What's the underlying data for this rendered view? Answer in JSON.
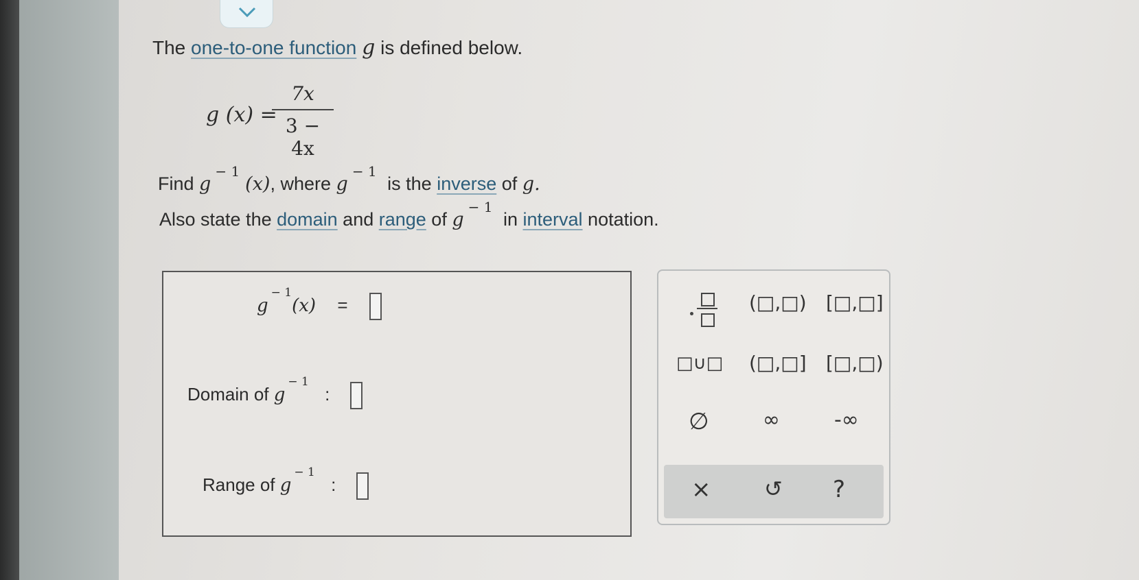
{
  "question": {
    "intro_pre": "The ",
    "intro_link": "one-to-one function",
    "intro_var": "g",
    "intro_post": " is defined below.",
    "formula_lhs": "g (x) =",
    "formula_num": "7x",
    "formula_den": "3 − 4x",
    "find_pre": "Find ",
    "find_g": "g",
    "find_x": "(x)",
    "find_where": ", where ",
    "find_g2": "g",
    "find_is": " is the ",
    "find_link": "inverse",
    "find_of": " of ",
    "find_g3": "g.",
    "also_pre": "Also state the ",
    "also_domain": "domain",
    "also_and": " and ",
    "also_range": "range",
    "also_of": " of ",
    "also_g": "g",
    "also_in": " in ",
    "also_interval": "interval",
    "also_post": " notation.",
    "inv_sup": "− 1"
  },
  "answer": {
    "inv_label_g": "g",
    "inv_label_x": "(x)",
    "equals": "=",
    "domain_label": "Domain of ",
    "range_label": "Range of ",
    "colon": ":",
    "sup": "− 1"
  },
  "palette": {
    "open_open": "(□,□)",
    "closed_closed": "[□,□]",
    "union": "□∪□",
    "open_closed": "(□,□]",
    "closed_open": "[□,□)",
    "empty_set": "∅",
    "infinity": "∞",
    "neg_infinity": "-∞",
    "clear": "×",
    "undo": "↺",
    "help": "?"
  }
}
